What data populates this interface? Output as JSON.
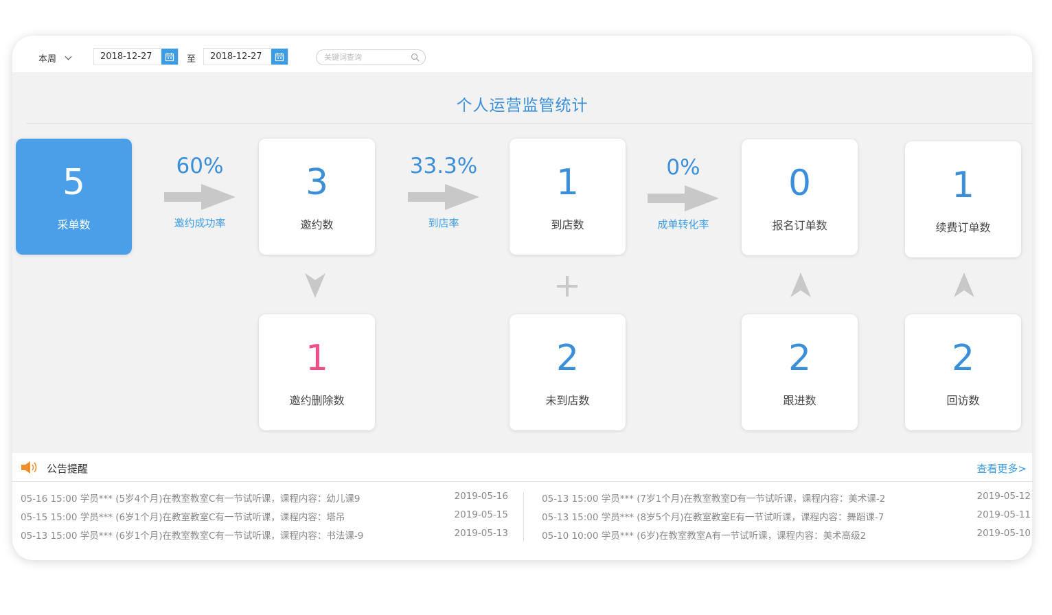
{
  "toolbar": {
    "period": "本周",
    "date_from": "2018-12-27",
    "to_label": "至",
    "date_to": "2018-12-27",
    "search_placeholder": "关键词查询"
  },
  "title": "个人运营监管统计",
  "cards": {
    "collect": {
      "value": "5",
      "label": "采单数"
    },
    "invite": {
      "value": "3",
      "label": "邀约数"
    },
    "arrive": {
      "value": "1",
      "label": "到店数"
    },
    "signup": {
      "value": "0",
      "label": "报名订单数"
    },
    "renew": {
      "value": "1",
      "label": "续费订单数"
    },
    "invite_delete": {
      "value": "1",
      "label": "邀约删除数"
    },
    "not_arrive": {
      "value": "2",
      "label": "未到店数"
    },
    "follow": {
      "value": "2",
      "label": "跟进数"
    },
    "revisit": {
      "value": "2",
      "label": "回访数"
    }
  },
  "rates": {
    "invite_success": {
      "value": "60%",
      "label": "邀约成功率"
    },
    "arrive_rate": {
      "value": "33.3%",
      "label": "到店率"
    },
    "conversion": {
      "value": "0%",
      "label": "成单转化率"
    }
  },
  "connector_plus": "+",
  "notices": {
    "title": "公告提醒",
    "more": "查看更多>",
    "left": [
      {
        "text": "05-16 15:00 学员*** (5岁4个月)在教室教室C有一节试听课，课程内容：幼儿课9",
        "date": "2019-05-16"
      },
      {
        "text": "05-15 15:00 学员*** (6岁1个月)在教室教室C有一节试听课，课程内容：塔吊",
        "date": "2019-05-15"
      },
      {
        "text": "05-13 15:00 学员*** (6岁1个月)在教室教室C有一节试听课，课程内容：书法课-9",
        "date": "2019-05-13"
      }
    ],
    "right": [
      {
        "text": "05-13 15:00 学员*** (7岁1个月)在教室教室D有一节试听课，课程内容：美术课-2",
        "date": "2019-05-12"
      },
      {
        "text": "05-13 15:00 学员*** (8岁5个月)在教室教室E有一节试听课，课程内容：舞蹈课-7",
        "date": "2019-05-11"
      },
      {
        "text": "05-10 10:00 学员*** (6岁)在教室教室A有一节试听课，课程内容：美术高级2",
        "date": "2019-05-10"
      }
    ]
  },
  "colors": {
    "accent": "#3a8fd8",
    "primary_card": "#4a9fe8",
    "pink": "#ee4f8b",
    "arrow": "#c8c8c8",
    "speaker": "#f0902c"
  }
}
